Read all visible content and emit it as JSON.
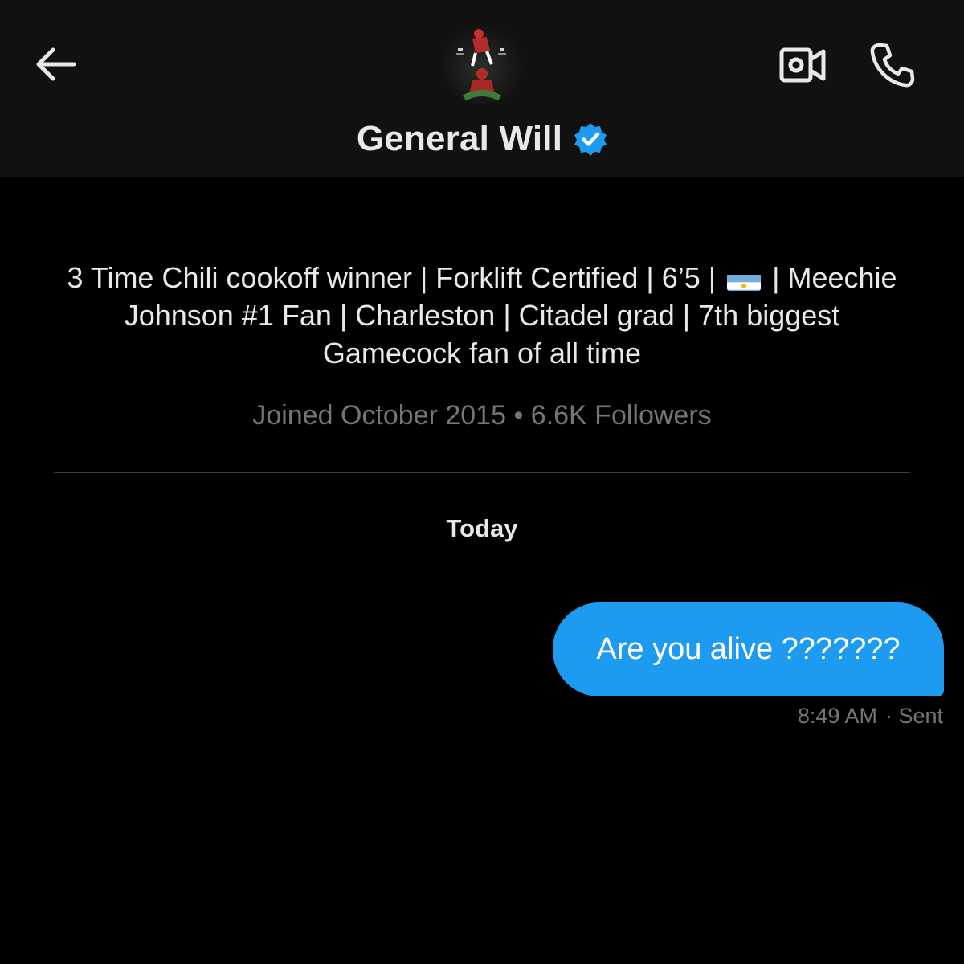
{
  "header": {
    "display_name": "General Will",
    "verified": true,
    "icons": {
      "back": "arrow-left-icon",
      "video": "video-call-icon",
      "call": "phone-icon",
      "verified": "verified-badge-icon"
    },
    "accent_color": "#1d9bf0"
  },
  "profile": {
    "bio_part1": "3 Time Chili cookoff winner | Forklift Certified | 6’5 |",
    "bio_flag": "argentina-flag",
    "bio_part2": "| Meechie Johnson #1 Fan | Charleston | Citadel grad | 7th biggest Gamecock fan of all time",
    "joined": "Joined October 2015",
    "separator": "•",
    "followers": "6.6K Followers"
  },
  "conversation": {
    "day_label": "Today",
    "messages": [
      {
        "text": "Are you alive ???????",
        "time": "8:49 AM",
        "status": "· Sent",
        "direction": "outgoing"
      }
    ]
  }
}
